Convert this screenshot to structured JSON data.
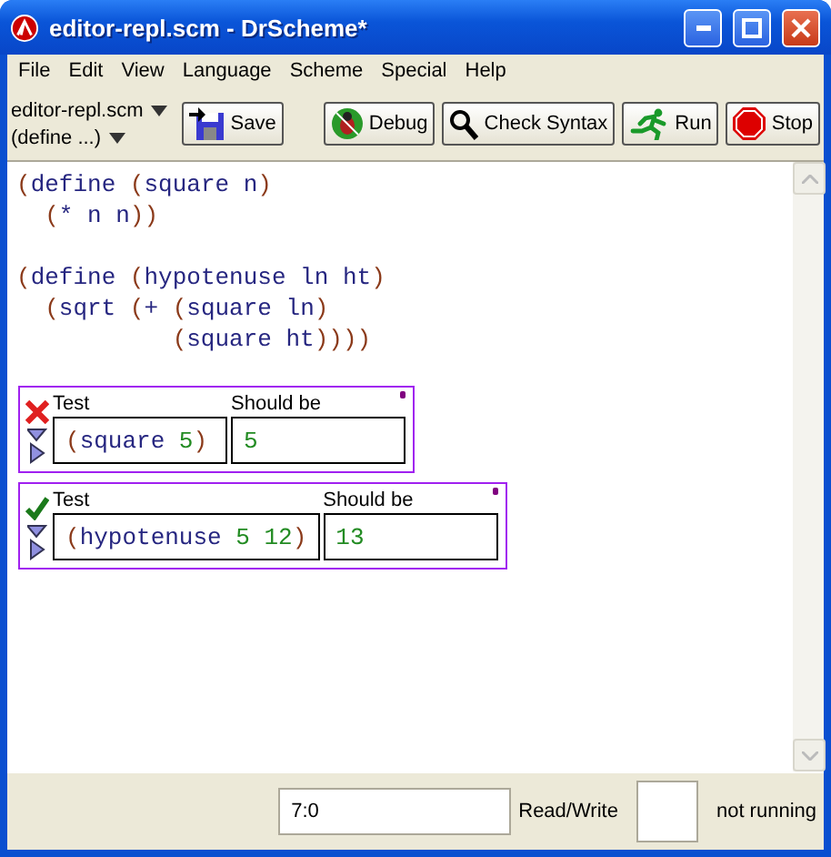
{
  "window": {
    "title": "editor-repl.scm - DrScheme*"
  },
  "menu": [
    "File",
    "Edit",
    "View",
    "Language",
    "Scheme",
    "Special",
    "Help"
  ],
  "toolbar": {
    "file_menu": "editor-repl.scm",
    "define_menu": "(define ...)",
    "buttons": [
      {
        "kind": "save",
        "label": "Save"
      },
      {
        "kind": "debug",
        "label": "Debug"
      },
      {
        "kind": "check",
        "label": "Check Syntax"
      },
      {
        "kind": "run",
        "label": "Run"
      },
      {
        "kind": "stop",
        "label": "Stop"
      }
    ]
  },
  "code": [
    [
      [
        {
          "kind": "paren",
          "text": "("
        },
        {
          "kind": "symbol",
          "text": "define "
        },
        {
          "kind": "paren",
          "text": "("
        },
        {
          "kind": "symbol",
          "text": "square n"
        },
        {
          "kind": "paren",
          "text": ")"
        }
      ],
      [
        {
          "kind": "paren",
          "text": "  ("
        },
        {
          "kind": "symbol",
          "text": "* n n"
        },
        {
          "kind": "paren",
          "text": "))"
        }
      ]
    ],
    [
      [
        {
          "kind": "paren",
          "text": "("
        },
        {
          "kind": "symbol",
          "text": "define "
        },
        {
          "kind": "paren",
          "text": "("
        },
        {
          "kind": "symbol",
          "text": "hypotenuse ln ht"
        },
        {
          "kind": "paren",
          "text": ")"
        }
      ],
      [
        {
          "kind": "paren",
          "text": "  ("
        },
        {
          "kind": "symbol",
          "text": "sqrt "
        },
        {
          "kind": "paren",
          "text": "("
        },
        {
          "kind": "symbol",
          "text": "+ "
        },
        {
          "kind": "paren",
          "text": "("
        },
        {
          "kind": "symbol",
          "text": "square ln"
        },
        {
          "kind": "paren",
          "text": ")"
        }
      ],
      [
        {
          "kind": "paren",
          "text": "           ("
        },
        {
          "kind": "symbol",
          "text": "square ht"
        },
        {
          "kind": "paren",
          "text": "))))"
        }
      ]
    ]
  ],
  "tests": [
    {
      "passed": false,
      "test_label": "Test",
      "expected_label": "Should be",
      "expression": [
        {
          "kind": "paren",
          "text": "("
        },
        {
          "kind": "symbol",
          "text": "square "
        },
        {
          "kind": "number",
          "text": "5"
        },
        {
          "kind": "paren",
          "text": ")"
        }
      ],
      "expected": [
        {
          "kind": "number",
          "text": "5"
        }
      ]
    },
    {
      "passed": true,
      "test_label": "Test",
      "expected_label": "Should be",
      "expression": [
        {
          "kind": "paren",
          "text": "("
        },
        {
          "kind": "symbol",
          "text": "hypotenuse "
        },
        {
          "kind": "number",
          "text": "5 12"
        },
        {
          "kind": "paren",
          "text": ")"
        }
      ],
      "expected": [
        {
          "kind": "number",
          "text": "13"
        }
      ]
    }
  ],
  "status_bar": {
    "position": "7:0",
    "mode": "Read/Write",
    "state": "not running"
  }
}
